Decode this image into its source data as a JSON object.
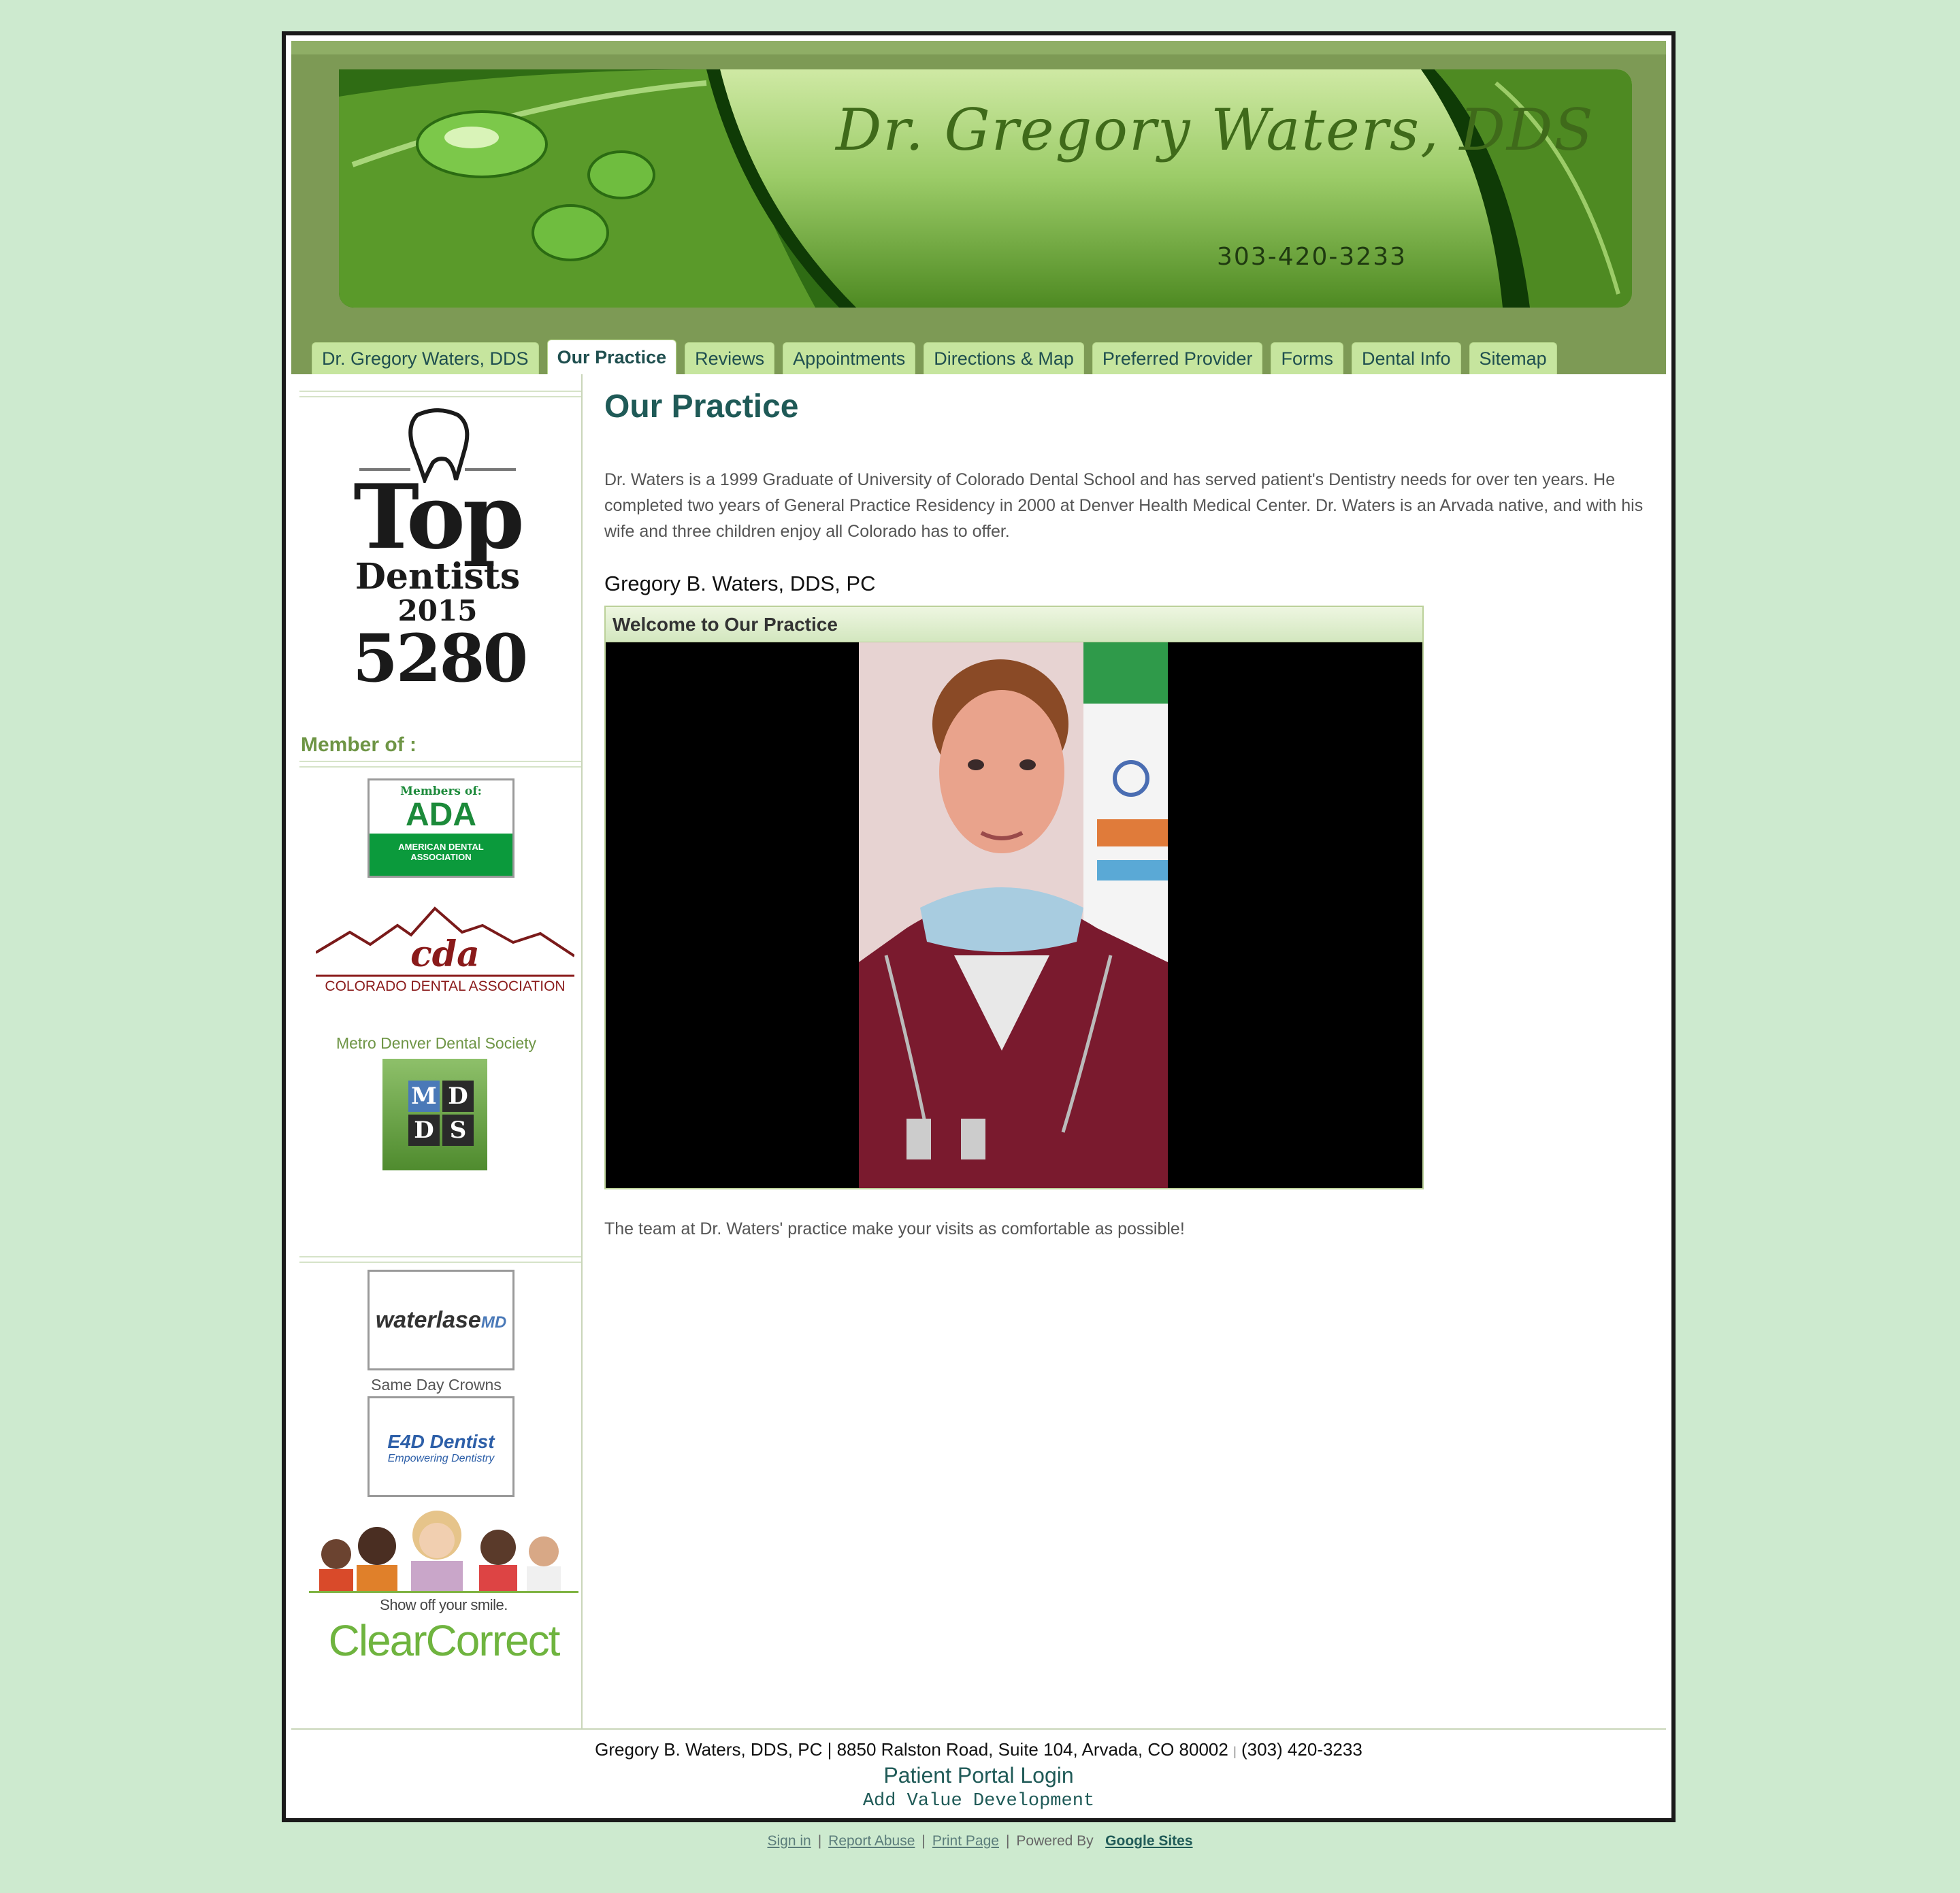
{
  "header": {
    "banner_title": "Dr. Gregory Waters, DDS",
    "banner_phone": "303-420-3233"
  },
  "nav": {
    "tabs": [
      {
        "label": "Dr. Gregory Waters, DDS",
        "active": false
      },
      {
        "label": "Our Practice",
        "active": true
      },
      {
        "label": "Reviews",
        "active": false
      },
      {
        "label": "Appointments",
        "active": false
      },
      {
        "label": "Directions & Map",
        "active": false
      },
      {
        "label": "Preferred Provider",
        "active": false
      },
      {
        "label": "Forms",
        "active": false
      },
      {
        "label": "Dental Info",
        "active": false
      },
      {
        "label": "Sitemap",
        "active": false
      }
    ]
  },
  "sidebar": {
    "top_dentists": {
      "top": "Top",
      "dentists": "Dentists",
      "year": "2015",
      "number": "5280"
    },
    "member_label": "Member of :",
    "ada": {
      "members_of": "Members of:",
      "logo": "ADA",
      "name": "AMERICAN DENTAL ASSOCIATION"
    },
    "cda": {
      "logo": "cda",
      "name": "COLORADO DENTAL ASSOCIATION"
    },
    "mdds_label": "Metro Denver Dental Society",
    "mdds_letters": [
      "M",
      "D",
      "D",
      "S"
    ],
    "waterlase": {
      "name": "waterlase",
      "suffix": "MD"
    },
    "crowns_label": "Same Day Crowns",
    "e4d": {
      "name": "E4D Dentist",
      "tagline": "Empowering Dentistry"
    },
    "clearcorrect": {
      "tagline": "Show off your smile.",
      "logo": "ClearCorrect"
    }
  },
  "main": {
    "title": "Our Practice",
    "intro": "Dr. Waters is a 1999 Graduate of University of Colorado Dental School and has served patient's Dentistry needs for over ten years.  He completed two years of General Practice Residency in 2000 at Denver Health Medical Center.  Dr. Waters is an Arvada native, and with his wife and three children enjoy all Colorado has to offer.",
    "subheading": "Gregory B. Waters, DDS, PC",
    "video_title": "Welcome to Our Practice",
    "closing": "The team at Dr. Waters' practice make your visits as comfortable as possible!"
  },
  "footer": {
    "address": "Gregory B. Waters, DDS, PC | 8850 Ralston Road, Suite 104, Arvada, CO 80002",
    "separator": "|",
    "phone": "(303) 420-3233",
    "portal": "Patient Portal Login",
    "credit": "Add Value Development"
  },
  "bottom_bar": {
    "sign_in": "Sign in",
    "report_abuse": "Report Abuse",
    "print_page": "Print Page",
    "powered_by": "Powered By",
    "google_sites": "Google Sites",
    "pipe": "|"
  },
  "colors": {
    "background": "#cdeacf",
    "header_green": "#7d9a55",
    "tab_green": "#c6e59e",
    "title_teal": "#1f5a57"
  }
}
